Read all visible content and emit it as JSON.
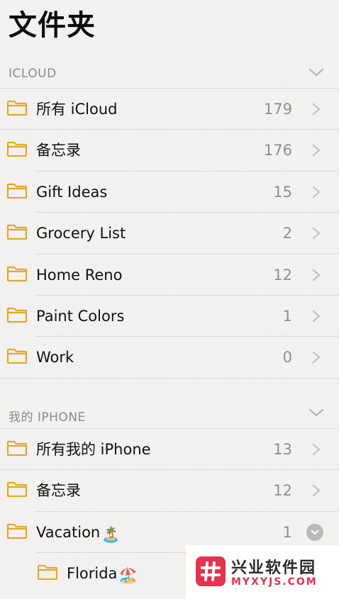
{
  "page": {
    "title": "文件夹"
  },
  "sections": {
    "icloud": {
      "label": "ICLOUD"
    },
    "iphone": {
      "label": "我的 IPHONE"
    }
  },
  "icloud_folders": [
    {
      "name": "所有 iCloud",
      "count": "179"
    },
    {
      "name": "备忘录",
      "count": "176"
    },
    {
      "name": "Gift Ideas",
      "count": "15"
    },
    {
      "name": "Grocery List",
      "count": "2"
    },
    {
      "name": "Home Reno",
      "count": "12"
    },
    {
      "name": "Paint Colors",
      "count": "1"
    },
    {
      "name": "Work",
      "count": "0"
    }
  ],
  "iphone_folders": [
    {
      "name": "所有我的 iPhone",
      "count": "13"
    },
    {
      "name": "备忘录",
      "count": "12"
    },
    {
      "name": "Vacation",
      "count": "1",
      "emoji": "🏝️"
    },
    {
      "name": "Florida",
      "emoji": "🏖️"
    }
  ],
  "watermark": {
    "cn": "兴业软件园",
    "en": "MYXYJS.COM"
  },
  "colors": {
    "folder": "#e2a92b",
    "accent": "#e3334f"
  }
}
